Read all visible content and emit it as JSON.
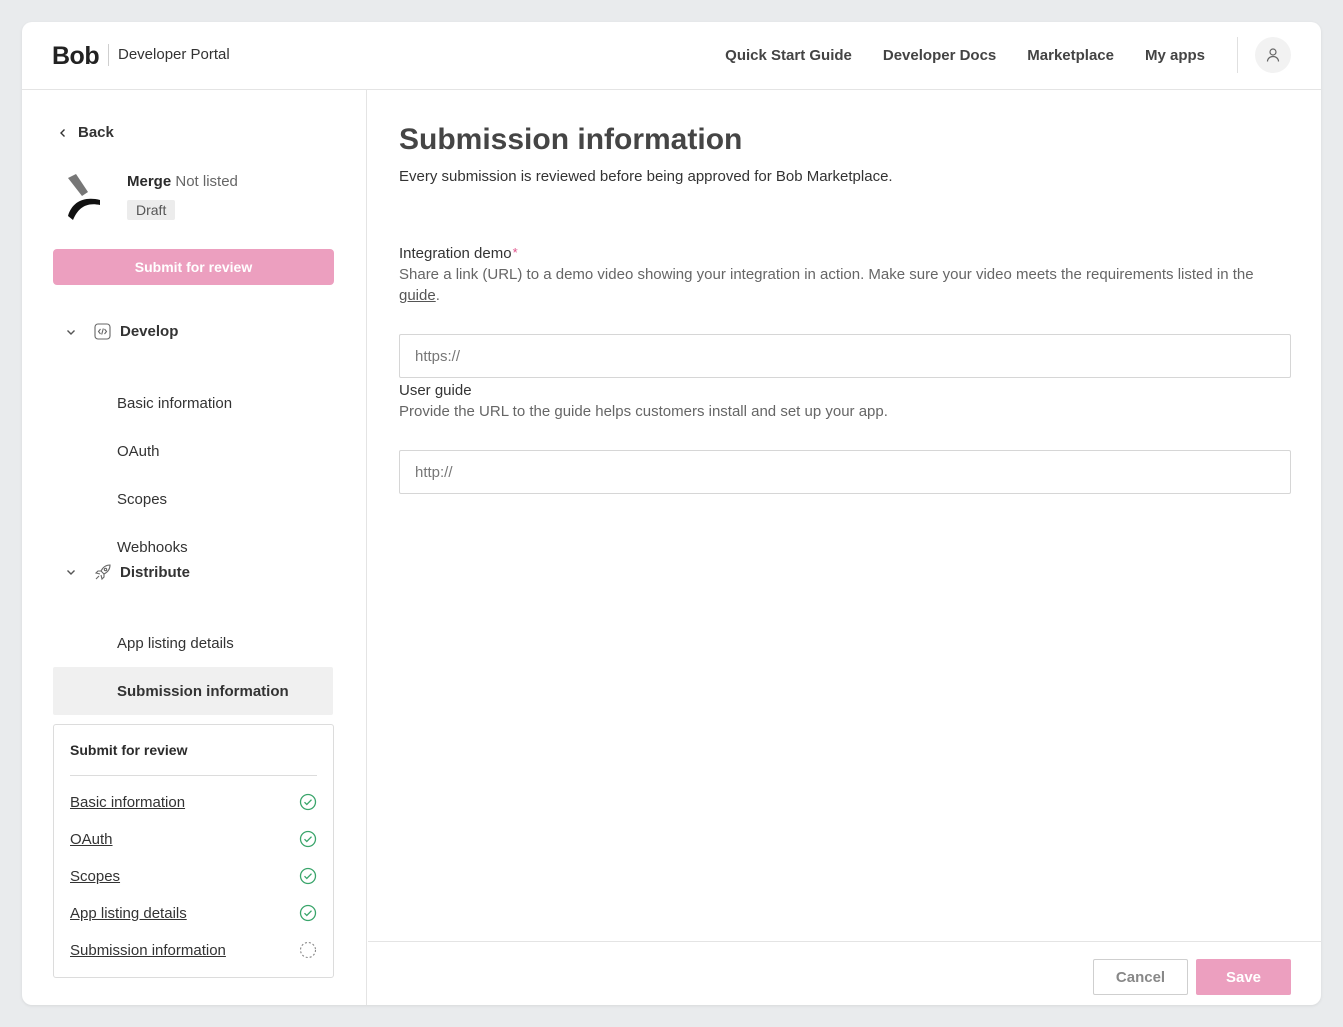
{
  "header": {
    "logo": "Bob",
    "portal_name": "Developer Portal",
    "nav": [
      "Quick Start Guide",
      "Developer Docs",
      "Marketplace",
      "My apps"
    ]
  },
  "sidebar": {
    "back_label": "Back",
    "app": {
      "name": "Merge",
      "listing_status": "Not listed",
      "badge": "Draft"
    },
    "submit_button": "Submit for review",
    "sections": [
      {
        "label": "Develop",
        "icon": "code-icon",
        "items": [
          "Basic information",
          "OAuth",
          "Scopes",
          "Webhooks"
        ]
      },
      {
        "label": "Distribute",
        "icon": "rocket-icon",
        "items": [
          "App listing details",
          "Submission information"
        ]
      }
    ],
    "active_item": "Submission information",
    "checklist": {
      "title": "Submit for review",
      "items": [
        {
          "label": "Basic information",
          "status": "complete"
        },
        {
          "label": "OAuth",
          "status": "complete"
        },
        {
          "label": "Scopes",
          "status": "complete"
        },
        {
          "label": "App listing details",
          "status": "complete"
        },
        {
          "label": "Submission information",
          "status": "pending"
        }
      ]
    }
  },
  "main": {
    "title": "Submission information",
    "subtitle": "Every submission is reviewed before being approved for Bob Marketplace.",
    "fields": [
      {
        "label": "Integration demo",
        "required_mark": "*",
        "help_before_link": "Share a link (URL) to a demo video showing your integration in action. Make sure your video meets the requirements listed in the ",
        "help_link": "guide",
        "help_after_link": ".",
        "value": "",
        "placeholder": "https://"
      },
      {
        "label": "User guide",
        "help": "Provide the URL to the guide helps customers install and set up your app.",
        "value": "",
        "placeholder": "http://"
      }
    ],
    "footer": {
      "cancel_label": "Cancel",
      "save_label": "Save"
    }
  },
  "colors": {
    "accent_pink": "#ec9fbf",
    "required_pink": "#e0528a",
    "check_green": "#3aa56b",
    "active_bg": "#f0f0f0"
  }
}
